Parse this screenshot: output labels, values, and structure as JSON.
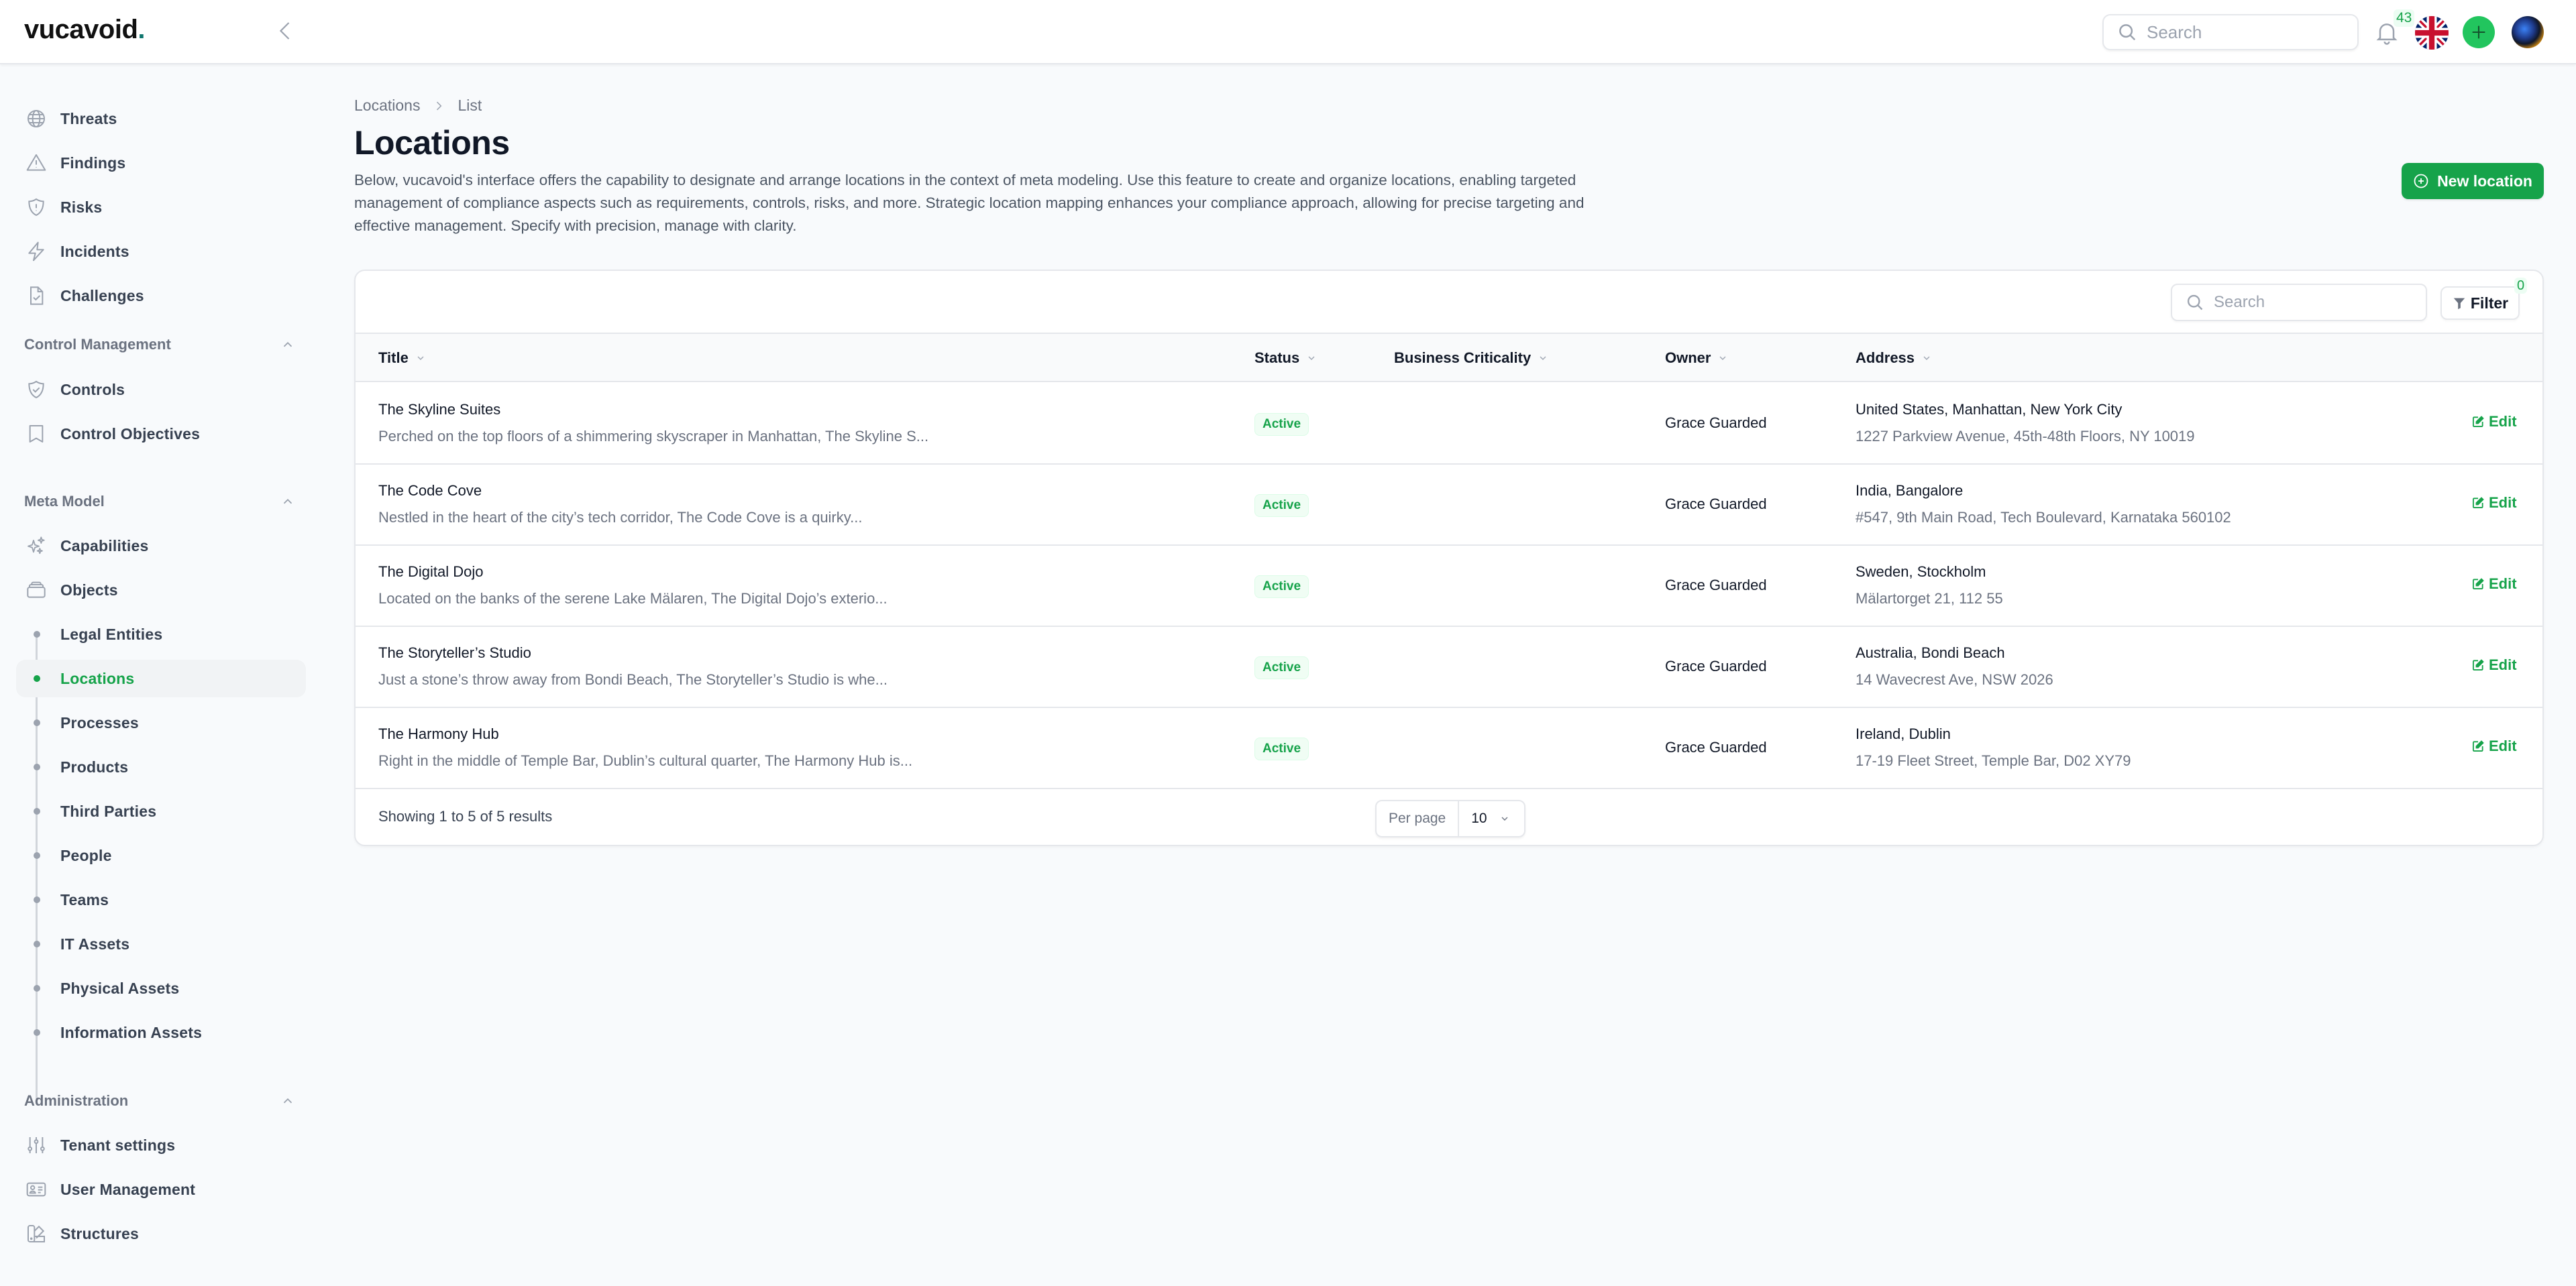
{
  "app": {
    "logo_text": "vucavoid",
    "logo_dot": ".",
    "accent_color": "#16a34a"
  },
  "topbar": {
    "search_placeholder": "Search",
    "notifications_count": "43",
    "language": "en-GB",
    "icons": [
      "collapse-sidebar-icon",
      "search-icon",
      "bell-icon",
      "uk-flag-icon",
      "plus-icon",
      "user-avatar"
    ]
  },
  "sidebar": {
    "top_items": [
      {
        "label": "Threats",
        "icon": "globe-icon"
      },
      {
        "label": "Findings",
        "icon": "warning-triangle-icon"
      },
      {
        "label": "Risks",
        "icon": "shield-exclamation-icon"
      },
      {
        "label": "Incidents",
        "icon": "lightning-icon"
      },
      {
        "label": "Challenges",
        "icon": "document-check-icon"
      }
    ],
    "sections": [
      {
        "title": "Control Management",
        "items": [
          {
            "label": "Controls",
            "icon": "shield-check-icon"
          },
          {
            "label": "Control Objectives",
            "icon": "bookmark-icon"
          }
        ]
      },
      {
        "title": "Meta Model",
        "items": [
          {
            "label": "Capabilities",
            "icon": "sparkles-icon"
          },
          {
            "label": "Objects",
            "icon": "stack-icon"
          }
        ],
        "sub_items": [
          {
            "label": "Legal Entities"
          },
          {
            "label": "Locations",
            "active": true
          },
          {
            "label": "Processes"
          },
          {
            "label": "Products"
          },
          {
            "label": "Third Parties"
          },
          {
            "label": "People"
          },
          {
            "label": "Teams"
          },
          {
            "label": "IT Assets"
          },
          {
            "label": "Physical Assets"
          },
          {
            "label": "Information Assets"
          }
        ]
      },
      {
        "title": "Administration",
        "items": [
          {
            "label": "Tenant settings",
            "icon": "sliders-icon"
          },
          {
            "label": "User Management",
            "icon": "id-card-icon"
          },
          {
            "label": "Structures",
            "icon": "swatch-icon"
          }
        ]
      }
    ]
  },
  "main": {
    "breadcrumb": [
      "Locations",
      "List"
    ],
    "title": "Locations",
    "description": "Below, vucavoid's interface offers the capability to designate and arrange locations in the context of meta modeling. Use this feature to create and organize locations, enabling targeted management of compliance aspects such as requirements, controls, risks, and more. Strategic location mapping enhances your compliance approach, allowing for precise targeting and effective management. Specify with precision, manage with clarity.",
    "new_button_label": "New location",
    "table": {
      "search_placeholder": "Search",
      "filter_label": "Filter",
      "filter_count": "0",
      "columns": [
        "Title",
        "Status",
        "Business Criticality",
        "Owner",
        "Address"
      ],
      "edit_label": "Edit",
      "rows": [
        {
          "title": "The Skyline Suites",
          "description": "Perched on the top floors of a shimmering skyscraper in Manhattan, The Skyline S...",
          "status": "Active",
          "business_criticality": "",
          "owner": "Grace Guarded",
          "address_line1": "United States, Manhattan, New York City",
          "address_line2": "1227 Parkview Avenue, 45th-48th Floors, NY 10019"
        },
        {
          "title": "The Code Cove",
          "description": "Nestled in the heart of the city’s tech corridor, The Code Cove is a quirky...",
          "status": "Active",
          "business_criticality": "",
          "owner": "Grace Guarded",
          "address_line1": "India, Bangalore",
          "address_line2": "#547, 9th Main Road, Tech Boulevard, Karnataka 560102"
        },
        {
          "title": "The Digital Dojo",
          "description": "Located on the banks of the serene Lake Mälaren, The Digital Dojo’s exterio...",
          "status": "Active",
          "business_criticality": "",
          "owner": "Grace Guarded",
          "address_line1": "Sweden, Stockholm",
          "address_line2": "Mälartorget 21, 112 55"
        },
        {
          "title": "The Storyteller’s Studio",
          "description": "Just a stone’s throw away from Bondi Beach, The Storyteller’s Studio is whe...",
          "status": "Active",
          "business_criticality": "",
          "owner": "Grace Guarded",
          "address_line1": "Australia, Bondi Beach",
          "address_line2": "14 Wavecrest Ave, NSW 2026"
        },
        {
          "title": "The Harmony Hub",
          "description": "Right in the middle of Temple Bar, Dublin’s cultural quarter, The Harmony Hub is...",
          "status": "Active",
          "business_criticality": "",
          "owner": "Grace Guarded",
          "address_line1": "Ireland, Dublin",
          "address_line2": "17-19 Fleet Street, Temple Bar, D02 XY79"
        }
      ],
      "footer": {
        "showing_text": "Showing 1 to 5 of 5 results",
        "per_page_label": "Per page",
        "per_page_value": "10"
      }
    }
  }
}
